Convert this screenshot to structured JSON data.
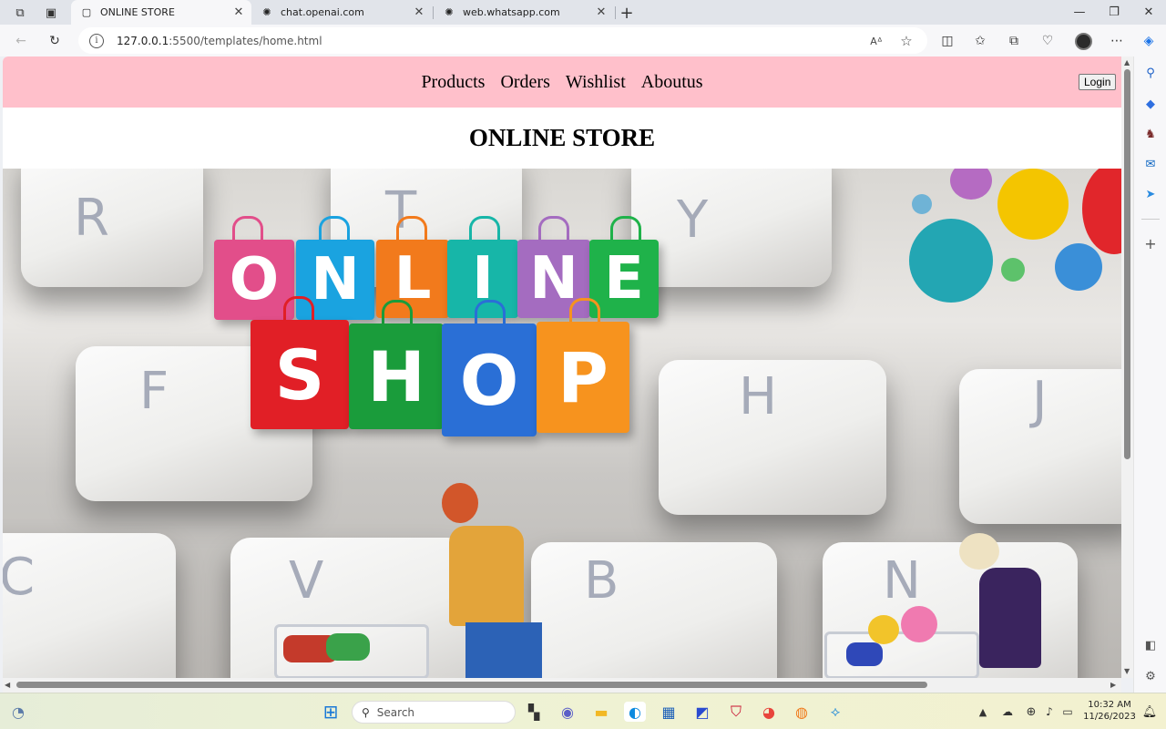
{
  "browser": {
    "tabs": [
      {
        "label": "ONLINE STORE",
        "active": true
      },
      {
        "label": "chat.openai.com",
        "active": false
      },
      {
        "label": "web.whatsapp.com",
        "active": false
      }
    ],
    "new_tab_glyph": "+",
    "url_host": "127.0.0.1",
    "url_path": ":5500/templates/home.html"
  },
  "page": {
    "nav_links": [
      "Products",
      "Orders",
      "Wishlist",
      "Aboutus"
    ],
    "login_label": "Login",
    "title": "ONLINE STORE",
    "hero_word_top": [
      "O",
      "N",
      "L",
      "I",
      "N",
      "E"
    ],
    "hero_word_bottom": [
      "S",
      "H",
      "O",
      "P"
    ],
    "hero_key_letters": [
      "R",
      "T",
      "Y",
      "F",
      "H",
      "J",
      "C",
      "V",
      "B",
      "N"
    ]
  },
  "taskbar": {
    "search_placeholder": "Search",
    "time": "10:32 AM",
    "date": "11/26/2023"
  },
  "colors": {
    "navbar_bg": "#ffc0cb",
    "bag_colors": [
      "#e24e8a",
      "#1aa3e0",
      "#f27a1c",
      "#17b6a8",
      "#a46cc0",
      "#1fb24a",
      "#e11f26",
      "#1a9c3b",
      "#2a6fd6",
      "#f7931e"
    ]
  }
}
